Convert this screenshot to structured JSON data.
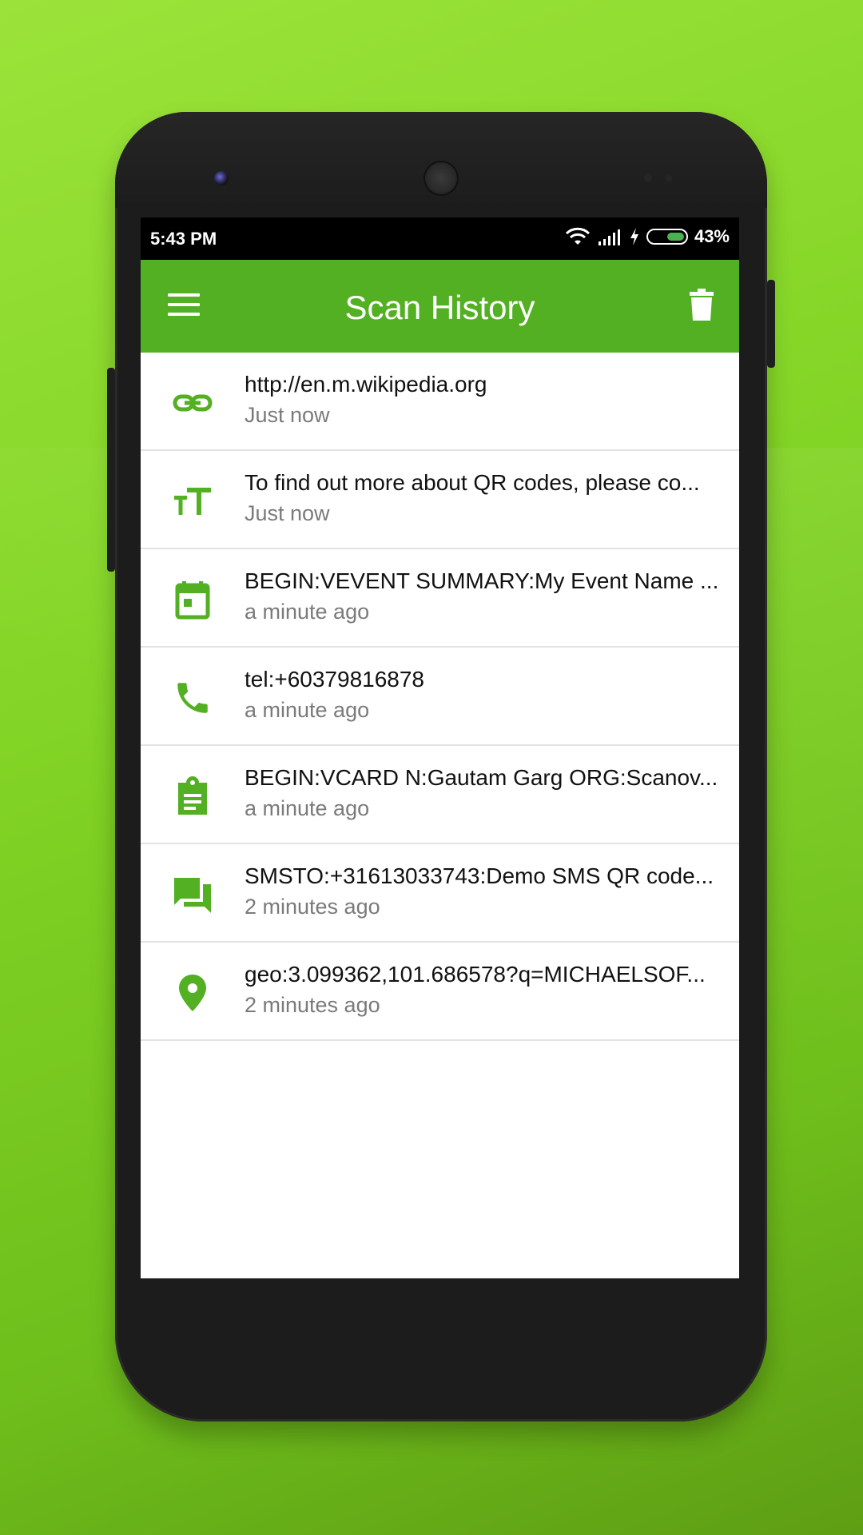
{
  "colors": {
    "accent": "#52b022",
    "background_green": "#8bd92d",
    "phone_body": "#1c1c1c"
  },
  "status_bar": {
    "time": "5:43 PM",
    "battery_percent": "43%",
    "battery_level": 0.43
  },
  "app_bar": {
    "title": "Scan History",
    "menu_icon": "hamburger-menu-icon",
    "action_icon": "trash-icon"
  },
  "history": [
    {
      "icon": "link-icon",
      "title": "http://en.m.wikipedia.org",
      "time": "Just now"
    },
    {
      "icon": "text-size-icon",
      "title": "To find out more about QR codes, please co...",
      "time": "Just now"
    },
    {
      "icon": "calendar-icon",
      "title": "BEGIN:VEVENT SUMMARY:My Event Name ...",
      "time": "a minute ago"
    },
    {
      "icon": "phone-icon",
      "title": "tel:+60379816878",
      "time": "a minute ago"
    },
    {
      "icon": "contact-card-icon",
      "title": "BEGIN:VCARD N:Gautam Garg ORG:Scanov...",
      "time": "a minute ago"
    },
    {
      "icon": "sms-icon",
      "title": "SMSTO:+31613033743:Demo SMS QR code...",
      "time": "2 minutes ago"
    },
    {
      "icon": "location-pin-icon",
      "title": "geo:3.099362,101.686578?q=MICHAELSOF...",
      "time": "2 minutes ago"
    }
  ]
}
